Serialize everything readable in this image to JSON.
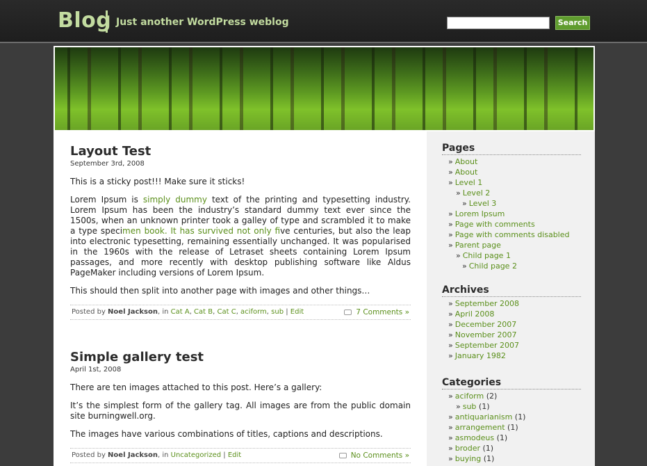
{
  "header": {
    "blog_title": "Blog",
    "tagline": "Just another WordPress weblog",
    "search_placeholder": "",
    "search_button": "Search"
  },
  "posts": [
    {
      "title": "Layout Test",
      "date": "September 3rd, 2008",
      "p1": "This is a sticky post!!! Make sure it sticks!",
      "p2_a": "Lorem Ipsum is ",
      "p2_link1": "simply dummy",
      "p2_b": " text of the printing and typesetting industry. Lorem Ipsum has been the industry’s standard dummy text ever since the 1500s, when an unknown printer took a galley of type and scrambled it to make a type speci",
      "p2_link2": "men book. It has survived not only fi",
      "p2_c": "ve centuries, but also the leap into electronic typesetting, remaining essentially unchanged. It was popularised in the 1960s with the release of Letraset sheets containing Lorem Ipsum passages, and more recently with desktop publishing software like Aldus PageMaker including versions of Lorem Ipsum.",
      "p3": "This should then split into another page with images and other things…",
      "posted_by": "Posted by ",
      "author": "Noel Jackson",
      "in": ", in ",
      "cats": [
        "Cat A",
        "Cat B",
        "Cat C",
        "aciform",
        "sub"
      ],
      "edit": "Edit",
      "comments": "7 Comments »"
    },
    {
      "title": "Simple gallery test",
      "date": "April 1st, 2008",
      "p1": "There are ten images attached to this post.  Here’s a gallery:",
      "p2": "It’s the simplest form of the gallery tag.  All images are from the public domain site burningwell.org.",
      "p3": "The images have various combinations of titles, captions and descriptions.",
      "posted_by": "Posted by ",
      "author": "Noel Jackson",
      "in": ", in ",
      "cats": [
        "Uncategorized"
      ],
      "edit": "Edit",
      "comments": "No Comments »"
    }
  ],
  "sidebar": {
    "pages_title": "Pages",
    "pages": [
      {
        "label": "About",
        "level": 1
      },
      {
        "label": "About",
        "level": 1
      },
      {
        "label": "Level 1",
        "level": 1
      },
      {
        "label": "Level 2",
        "level": 2
      },
      {
        "label": "Level 3",
        "level": 3
      },
      {
        "label": "Lorem Ipsum",
        "level": 1
      },
      {
        "label": "Page with comments",
        "level": 1
      },
      {
        "label": "Page with comments disabled",
        "level": 1
      },
      {
        "label": "Parent page",
        "level": 1
      },
      {
        "label": "Child page 1",
        "level": 2
      },
      {
        "label": "Child page 2",
        "level": 3
      }
    ],
    "archives_title": "Archives",
    "archives": [
      "September 2008",
      "April 2008",
      "December 2007",
      "November 2007",
      "September 2007",
      "January 1982"
    ],
    "categories_title": "Categories",
    "categories": [
      {
        "label": "aciform",
        "count": "(2)",
        "level": 1
      },
      {
        "label": "sub",
        "count": "(1)",
        "level": 2
      },
      {
        "label": "antiquarianism",
        "count": "(1)",
        "level": 1
      },
      {
        "label": "arrangement",
        "count": "(1)",
        "level": 1
      },
      {
        "label": "asmodeus",
        "count": "(1)",
        "level": 1
      },
      {
        "label": "broder",
        "count": "(1)",
        "level": 1
      },
      {
        "label": "buying",
        "count": "(1)",
        "level": 1
      }
    ]
  },
  "colors": {
    "link": "#5a8f1a",
    "header_text": "#c3dca0",
    "search_button": "#5f9c2e"
  }
}
